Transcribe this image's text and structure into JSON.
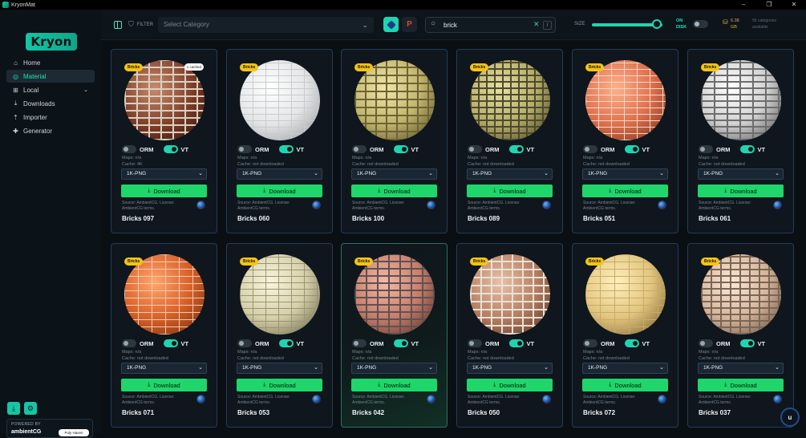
{
  "window": {
    "title": "KryonMat",
    "controls": [
      "–",
      "❐",
      "✕"
    ]
  },
  "logo": "Kryon",
  "nav": [
    {
      "label": "Home",
      "icon": "home-icon",
      "glyph": "⌂",
      "active": false
    },
    {
      "label": "Material",
      "icon": "material-icon",
      "glyph": "◎",
      "active": true
    },
    {
      "label": "Local",
      "icon": "local-folder-icon",
      "glyph": "⊞",
      "active": false,
      "expand": "⌄"
    },
    {
      "label": "Downloads",
      "icon": "downloads-icon",
      "glyph": "⤓",
      "active": false
    },
    {
      "label": "Importer",
      "icon": "importer-icon",
      "glyph": "⇡",
      "active": false
    },
    {
      "label": "Generator",
      "icon": "generator-icon",
      "glyph": "✚",
      "active": false
    }
  ],
  "sidebar_footer": {
    "powered_by": "POWERED BY",
    "ambient": "ambientCG",
    "poly": "Poly Haven"
  },
  "topbar": {
    "filter_label": "FILTER",
    "category_placeholder": "Select Category",
    "search_value": "brick",
    "search_key": "/",
    "size_label": "SIZE",
    "size_value": 0.92,
    "on_disk_label": "ON\nDISK",
    "disk_value": "6.38\nGB",
    "categories_info": "56 categories\navailable"
  },
  "card_labels": {
    "badge": "Bricks",
    "orm": "ORM",
    "vt": "VT",
    "maps": "Maps: n/a",
    "format": "1K-PNG",
    "download": "Download",
    "source": "Source: AmbientCG. License:\nAmbientCG terms."
  },
  "cards": [
    {
      "name": "Bricks 097",
      "cache": "Cache: 4K",
      "cached_badge": "1 cached"
    },
    {
      "name": "Bricks 060",
      "cache": "Cache: not downloaded"
    },
    {
      "name": "Bricks 100",
      "cache": "Cache: not downloaded"
    },
    {
      "name": "Bricks 089",
      "cache": "Cache: not downloaded"
    },
    {
      "name": "Bricks 051",
      "cache": "Cache: not downloaded"
    },
    {
      "name": "Bricks 061",
      "cache": "Cache: not downloaded"
    },
    {
      "name": "Bricks 071",
      "cache": "Cache: not downloaded"
    },
    {
      "name": "Bricks 053",
      "cache": "Cache: not downloaded"
    },
    {
      "name": "Bricks 042",
      "cache": "Cache: not downloaded",
      "highlighted": true
    },
    {
      "name": "Bricks 050",
      "cache": "Cache: not downloaded"
    },
    {
      "name": "Bricks 072",
      "cache": "Cache: not downloaded"
    },
    {
      "name": "Bricks 037",
      "cache": "Cache: not downloaded"
    }
  ],
  "colors": {
    "accent": "#1fd5b1",
    "download": "#1ed66a",
    "badge": "#f3c417",
    "card_border": "#233d5a"
  }
}
